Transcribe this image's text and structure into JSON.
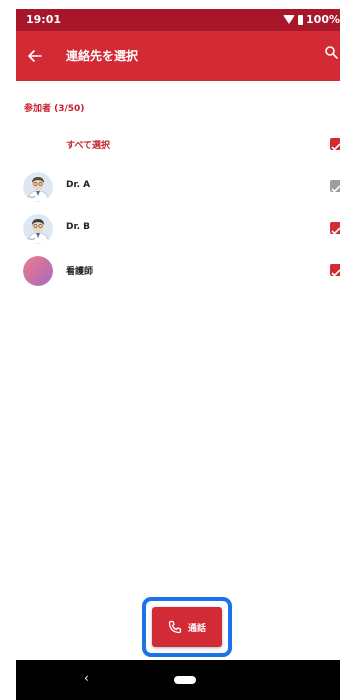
{
  "status_bar": {
    "time": "19:01",
    "battery_text": "100%"
  },
  "app_bar": {
    "title": "連絡先を選択",
    "back_icon": "arrow-left-icon",
    "search_icon": "search-icon"
  },
  "section_header": "参加者 (3/50)",
  "select_all": {
    "label": "すべて選択",
    "checked": true
  },
  "participants": [
    {
      "name": "Dr. A",
      "avatar": "doctor-avatar",
      "checked": true,
      "checkbox_color": "#9e9e9e"
    },
    {
      "name": "Dr. B",
      "avatar": "doctor-avatar",
      "checked": true,
      "checkbox_color": "#d22b36"
    },
    {
      "name": "看護師",
      "avatar": "gradient-avatar",
      "checked": true,
      "checkbox_color": "#d22b36"
    }
  ],
  "call_button": {
    "label": "通話",
    "icon": "phone-icon"
  },
  "colors": {
    "status_bar": "#a8162a",
    "app_bar": "#d22b36",
    "accent": "#c8202d",
    "highlight": "#1a73e8"
  }
}
